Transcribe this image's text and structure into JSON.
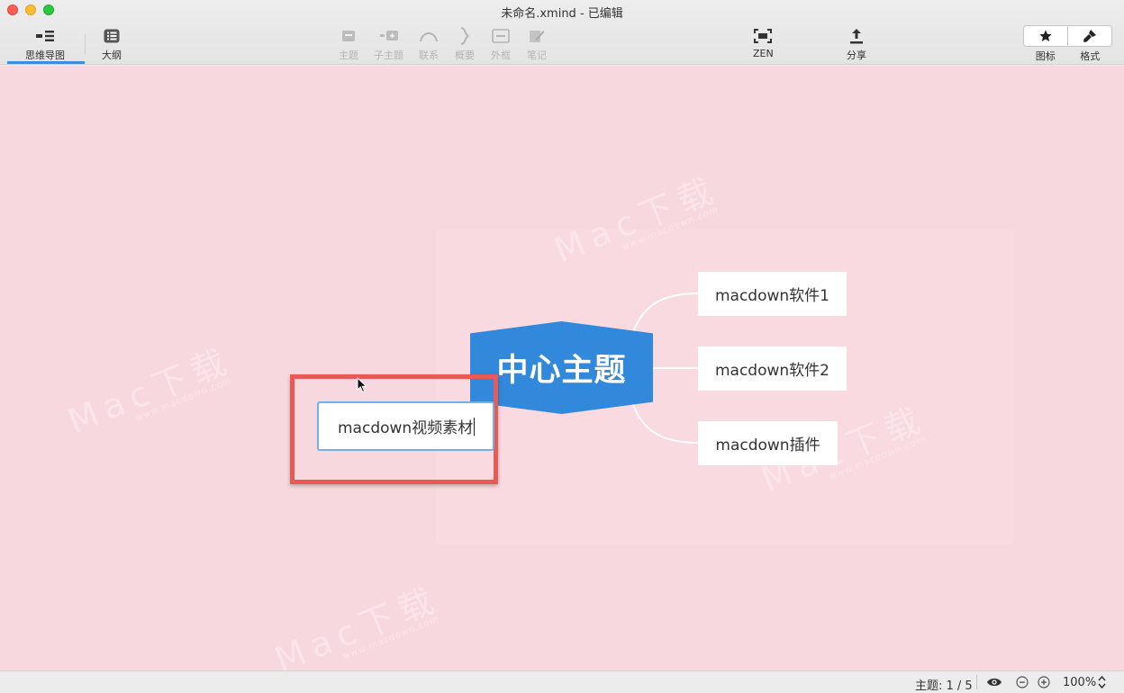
{
  "window": {
    "title": "未命名.xmind - 已编辑"
  },
  "toolbar": {
    "mindmap_label": "思维导图",
    "outline_label": "大纲",
    "topic_label": "主题",
    "subtopic_label": "子主题",
    "relation_label": "联系",
    "summary_label": "概要",
    "boundary_label": "外框",
    "note_label": "笔记",
    "zen_label": "ZEN",
    "share_label": "分享",
    "icon_label": "图标",
    "format_label": "格式"
  },
  "canvas": {
    "central_topic": "中心主题",
    "subtopics": [
      "macdown软件1",
      "macdown软件2",
      "macdown插件"
    ],
    "editing_topic_value": "macdown视频素材",
    "watermark_text": "Mac下载",
    "watermark_url": "www.macdown.com"
  },
  "statusbar": {
    "topic_count": "主题: 1 / 5",
    "zoom": "100%"
  },
  "colors": {
    "canvas_bg": "#f8d8df",
    "central_topic": "#3289dc",
    "highlight": "#e75a55",
    "accent": "#3b8de0"
  }
}
